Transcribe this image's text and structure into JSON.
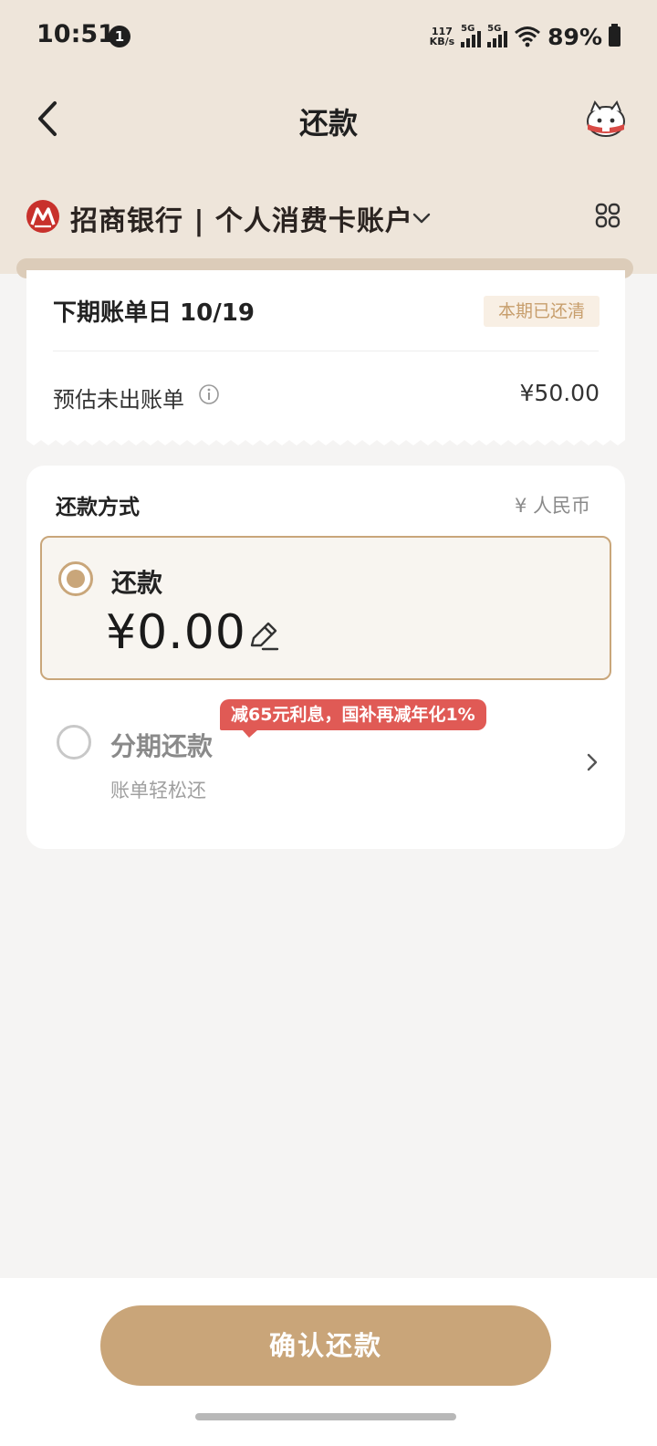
{
  "status_bar": {
    "time": "10:51",
    "notification_count": "1",
    "net_speed_value": "117",
    "net_speed_unit": "KB/s",
    "signal1_label": "5G",
    "signal2_label": "5G",
    "battery": "89%"
  },
  "nav": {
    "title": "还款"
  },
  "account": {
    "name": "招商银行 | 个人消费卡账户"
  },
  "bill": {
    "next_bill_date": "下期账单日 10/19",
    "paid_badge": "本期已还清",
    "estimate_label": "预估未出账单",
    "estimate_amount": "¥50.00"
  },
  "repayment": {
    "method_title": "还款方式",
    "currency": "¥ 人民币",
    "option_full": {
      "label": "还款",
      "amount": "¥0.00",
      "selected": true
    },
    "option_installment": {
      "label": "分期还款",
      "subtitle": "账单轻松还",
      "promo": "减65元利息，国补再减年化1%",
      "selected": false
    }
  },
  "footer": {
    "confirm_label": "确认还款"
  },
  "colors": {
    "header_bg": "#eee5da",
    "accent_gold": "#c9a579",
    "promo_red": "#e05a55",
    "bank_red": "#c8312c"
  }
}
